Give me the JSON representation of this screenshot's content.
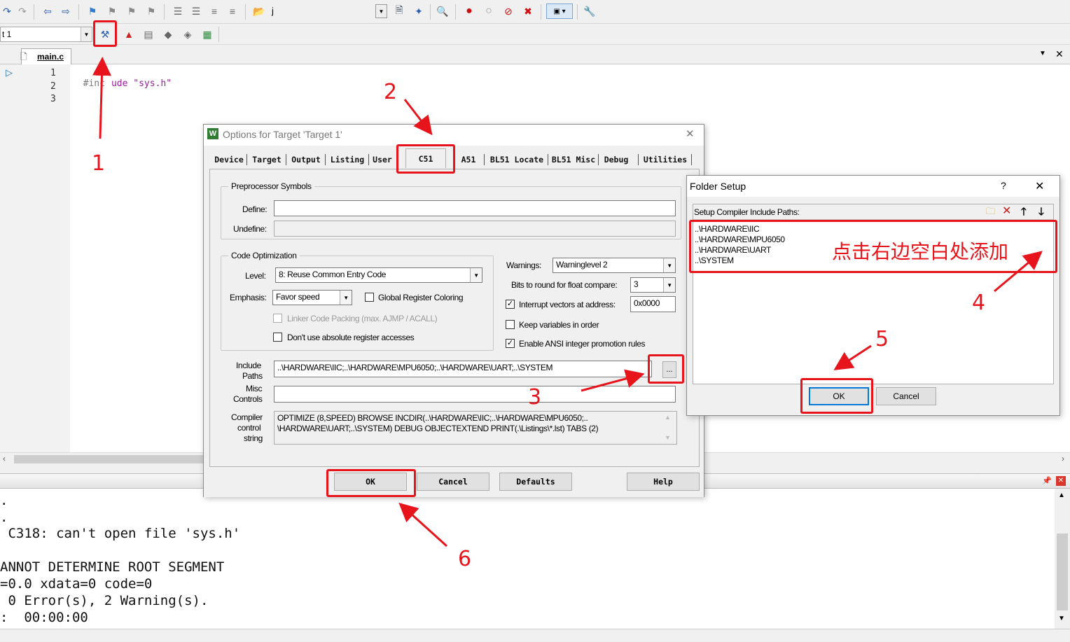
{
  "toolbar": {
    "partial_text": "j",
    "target_label": "t 1"
  },
  "editor": {
    "tab": "main.c",
    "lines": [
      {
        "n": "1",
        "pre": "#inc",
        "post": "ude \"sys.h\""
      },
      {
        "n": "2",
        "pre": "",
        "post": ""
      },
      {
        "n": "3",
        "pre": "",
        "post": ""
      }
    ]
  },
  "options_dialog": {
    "title": "Options for Target 'Target 1'",
    "tabs": [
      "Device",
      "Target",
      "Output",
      "Listing",
      "User",
      "C51",
      "A51",
      "BL51 Locate",
      "BL51 Misc",
      "Debug",
      "Utilities"
    ],
    "preprocessor": {
      "label": "Preprocessor Symbols",
      "define_label": "Define:",
      "undefine_label": "Undefine:",
      "define_value": "",
      "undefine_value": ""
    },
    "code_opt": {
      "label": "Code Optimization",
      "level_label": "Level:",
      "level_value": "8: Reuse Common Entry Code",
      "emphasis_label": "Emphasis:",
      "emphasis_value": "Favor speed",
      "global_reg": "Global Register Coloring",
      "linker_packing": "Linker Code Packing (max. AJMP / ACALL)",
      "dont_abs": "Don't use absolute register accesses"
    },
    "warnings_label": "Warnings:",
    "warnings_value": "Warninglevel 2",
    "bits_label": "Bits to round for float compare:",
    "bits_value": "3",
    "interrupt_label": "Interrupt vectors at address:",
    "interrupt_value": "0x0000",
    "keep_vars": "Keep variables in order",
    "enable_ansi": "Enable ANSI integer promotion rules",
    "include_label_1": "Include",
    "include_label_2": "Paths",
    "include_value": "..\\HARDWARE\\IIC;..\\HARDWARE\\MPU6050;..\\HARDWARE\\UART;..\\SYSTEM",
    "browse": "...",
    "misc_label_1": "Misc",
    "misc_label_2": "Controls",
    "misc_value": "",
    "compiler_label_1": "Compiler",
    "compiler_label_2": "control",
    "compiler_label_3": "string",
    "compiler_line_1": "OPTIMIZE (8,SPEED) BROWSE INCDIR(..\\HARDWARE\\IIC;..\\HARDWARE\\MPU6050;..",
    "compiler_line_2": "\\HARDWARE\\UART;..\\SYSTEM) DEBUG OBJECTEXTEND PRINT(.\\Listings\\*.lst) TABS (2)",
    "ok": "OK",
    "cancel": "Cancel",
    "defaults": "Defaults",
    "help": "Help"
  },
  "folder_dialog": {
    "title": "Folder Setup",
    "help": "?",
    "header": "Setup Compiler Include Paths:",
    "paths": [
      "..\\HARDWARE\\IIC",
      "..\\HARDWARE\\MPU6050",
      "..\\HARDWARE\\UART",
      "..\\SYSTEM"
    ],
    "ok": "OK",
    "cancel": "Cancel"
  },
  "annotations": {
    "n1": "1",
    "n2": "2",
    "n3": "3",
    "n4": "4",
    "n5": "5",
    "n6": "6",
    "hint": "点击右边空白处添加",
    "color": "#e8141c"
  },
  "output": {
    "lines": [
      ".",
      ".",
      " C318: can't open file 'sys.h'",
      "",
      "ANNOT DETERMINE ROOT SEGMENT",
      "=0.0 xdata=0 code=0",
      " 0 Error(s), 2 Warning(s).",
      ":  00:00:00"
    ]
  }
}
